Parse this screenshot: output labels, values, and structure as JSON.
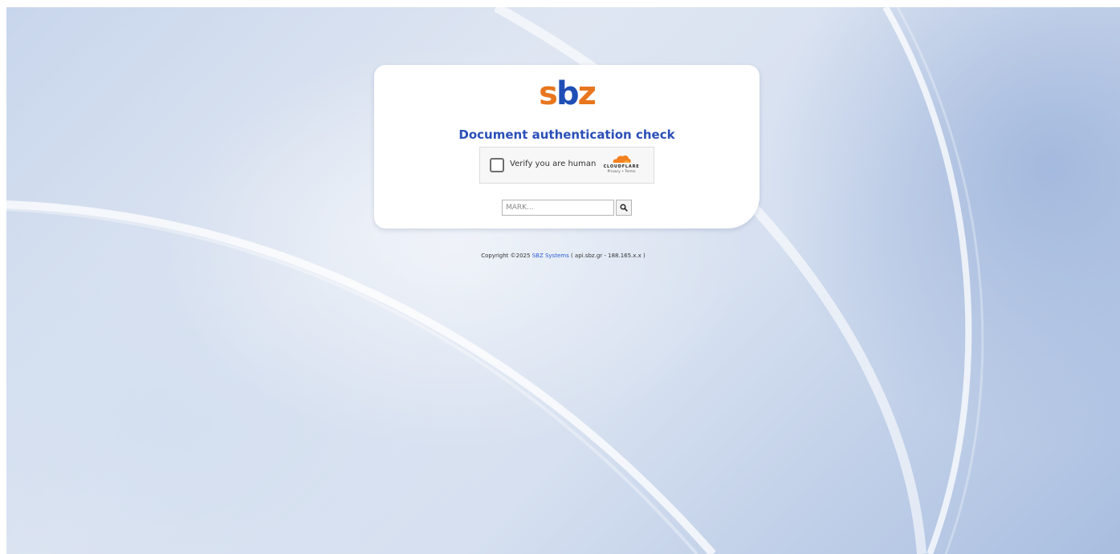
{
  "logo": {
    "s": "s",
    "b": "b",
    "z": "z",
    "colors": {
      "orange": "#e8761e",
      "blue": "#1f4fb6"
    }
  },
  "page": {
    "title": "Document authentication check"
  },
  "captcha": {
    "label": "Verify you are human",
    "brand": "CLOUDFLARE",
    "links": "Privacy • Terms",
    "brand_icon": "cloudflare-cloud-icon"
  },
  "search": {
    "placeholder": "MARK...",
    "value": "",
    "button_icon": "search-icon"
  },
  "footer": {
    "prefix": "Copyright ©2025",
    "link_text": "SBZ Systems",
    "suffix": "( api.sbz.gr - 188.165.x.x )"
  },
  "theme": {
    "title_color": "#2a4fb8",
    "link_color": "#2a5bd0"
  }
}
